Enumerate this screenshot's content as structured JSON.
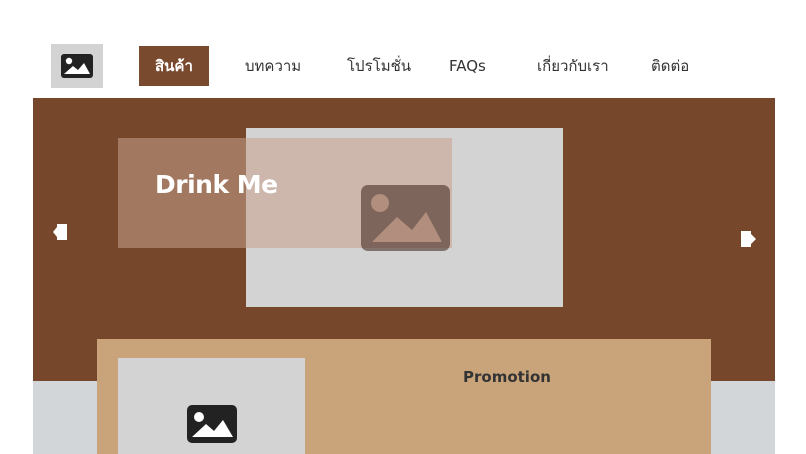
{
  "header": {
    "logo_icon": "image-placeholder-icon",
    "nav": [
      {
        "label": "สินค้า",
        "active": true
      },
      {
        "label": "บทความ",
        "active": false
      },
      {
        "label": "โปรโมชั่น",
        "active": false
      },
      {
        "label": "FAQs",
        "active": false
      },
      {
        "label": "เกี่ยวกับเรา",
        "active": false
      },
      {
        "label": "ติดต่อ",
        "active": false
      }
    ]
  },
  "hero": {
    "title": "Drink Me",
    "prev_icon": "arrow-left-icon",
    "next_icon": "arrow-right-icon",
    "image_icon": "image-placeholder-icon"
  },
  "promotion": {
    "title": "Promotion",
    "image_icon": "image-placeholder-icon"
  },
  "colors": {
    "brand_brown": "#77472c",
    "nav_active": "#7a4a2e",
    "promo_tan": "#c9a47b",
    "placeholder_gray": "#d3d3d3"
  }
}
